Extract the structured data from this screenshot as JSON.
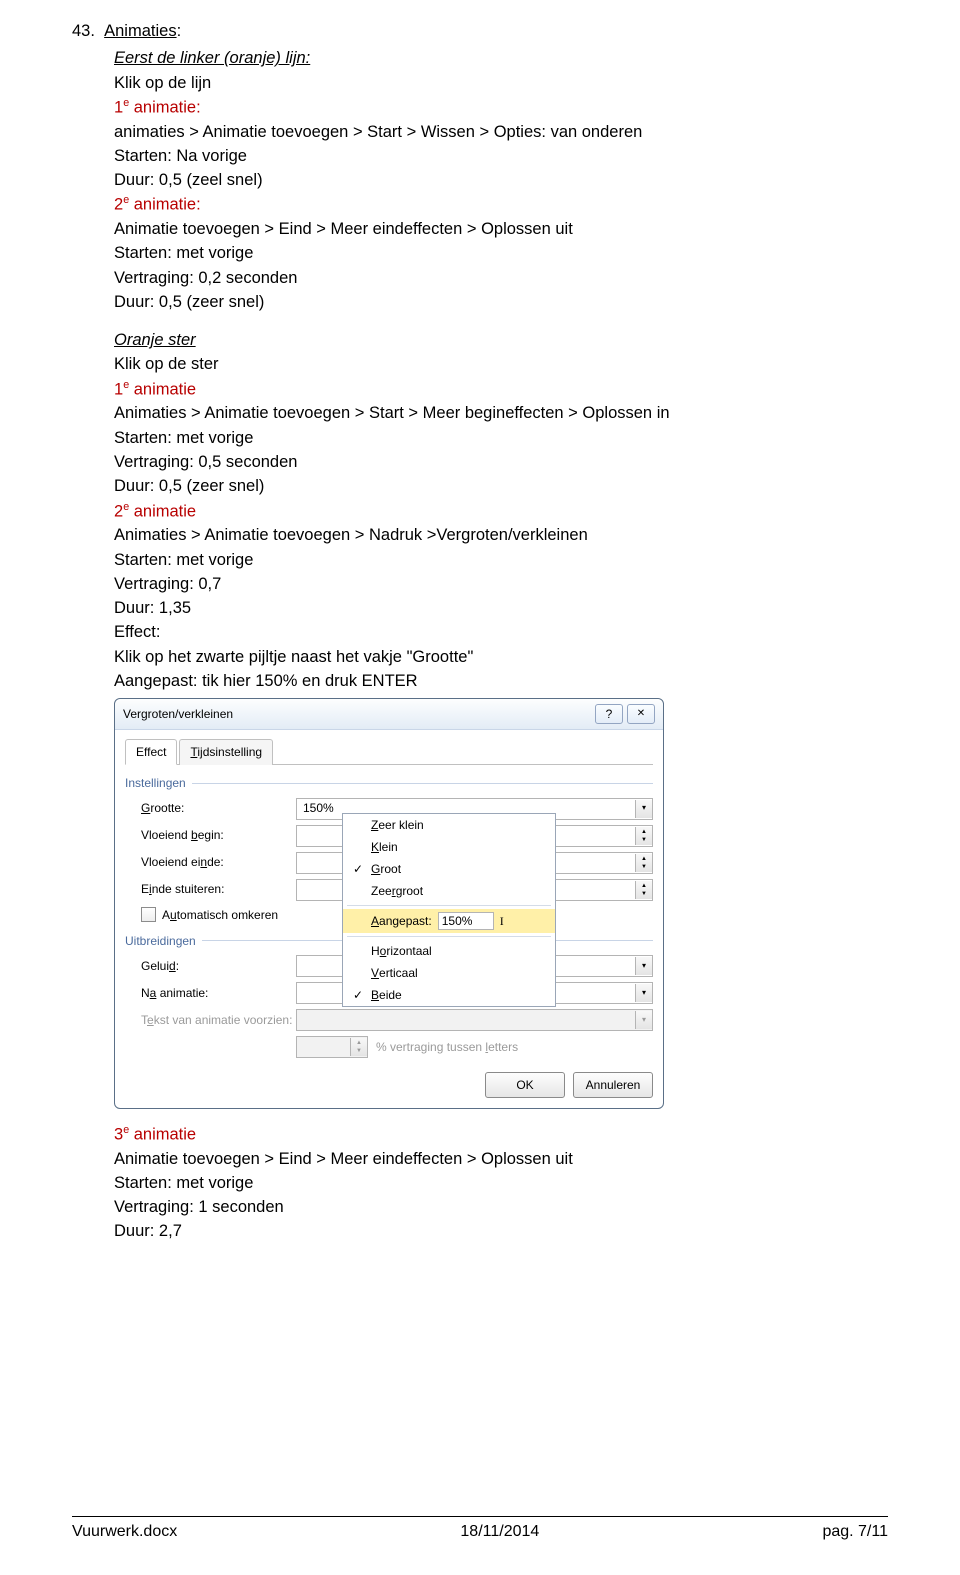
{
  "doc": {
    "section_number": "43.",
    "section_title": "Animaties",
    "b1": {
      "h": "Eerst de linker (oranje) lijn:",
      "l1": "Klik op de lijn",
      "anim1_label": "1",
      "anim1_sup": "e",
      "anim1_word": " animatie:",
      "a1_path": "animaties > Animatie toevoegen > Start > Wissen > Opties: van onderen",
      "a1_start": "Starten: Na vorige",
      "a1_dur": "Duur: 0,5 (zeel snel)",
      "anim2_label": "2",
      "anim2_sup": "e",
      "anim2_word": " animatie:",
      "a2_path": "Animatie toevoegen > Eind > Meer eindeffecten > Oplossen uit",
      "a2_start": "Starten: met vorige",
      "a2_delay": "Vertraging: 0,2 seconden",
      "a2_dur": "Duur: 0,5 (zeer snel)"
    },
    "b2": {
      "h": "Oranje ster",
      "l1": "Klik op de ster",
      "anim1_label": "1",
      "anim1_sup": "e",
      "anim1_word": " animatie",
      "a1_path": "Animaties > Animatie toevoegen > Start > Meer begineffecten > Oplossen in",
      "a1_start": "Starten: met vorige",
      "a1_delay": "Vertraging: 0,5 seconden",
      "a1_dur": "Duur: 0,5 (zeer snel)",
      "anim2_label": "2",
      "anim2_sup": "e",
      "anim2_word": " animatie",
      "a2_path": "Animaties > Animatie toevoegen > Nadruk >Vergroten/verkleinen",
      "a2_start": "Starten: met vorige",
      "a2_delay": "Vertraging: 0,7",
      "a2_dur": "Duur: 1,35",
      "a2_effect": "Effect:",
      "a2_note1": "Klik op het zwarte pijltje naast het vakje \"Grootte\"",
      "a2_note2": "Aangepast: tik hier 150% en druk ENTER"
    },
    "b3": {
      "anim3_label": "3",
      "anim3_sup": "e",
      "anim3_word": " animatie",
      "path": "Animatie toevoegen > Eind > Meer eindeffecten > Oplossen uit",
      "start": "Starten: met vorige",
      "delay": "Vertraging: 1 seconden",
      "dur": "Duur: 2,7"
    }
  },
  "dialog": {
    "title": "Vergroten/verkleinen",
    "xlabel": "",
    "tab_effect": "Effect",
    "tab_timing": "Tijdsinstelling",
    "grp_settings": "Instellingen",
    "lbl_size": "Grootte:",
    "val_size": "150%",
    "lbl_begin": "Vloeiend begin:",
    "lbl_end": "Vloeiend einde:",
    "lbl_bounce": "Einde stuiteren:",
    "cb_auto": "Automatisch omkeren",
    "grp_ext": "Uitbreidingen",
    "lbl_sound": "Geluid:",
    "lbl_after": "Na animatie:",
    "lbl_text": "Tekst van animatie voorzien:",
    "lbl_pct": "% vertraging tussen letters",
    "btn_ok": "OK",
    "btn_cancel": "Annuleren",
    "dd": {
      "i1": "Zeer klein",
      "i2": "Klein",
      "i3": "Groot",
      "i4": "Zeer groot",
      "custom_label": "Aangepast:",
      "custom_val": "150%",
      "i5": "Horizontaal",
      "i6": "Verticaal",
      "i7": "Beide"
    }
  },
  "footer": {
    "left": "Vuurwerk.docx",
    "center": "18/11/2014",
    "right": "pag. 7/11"
  }
}
